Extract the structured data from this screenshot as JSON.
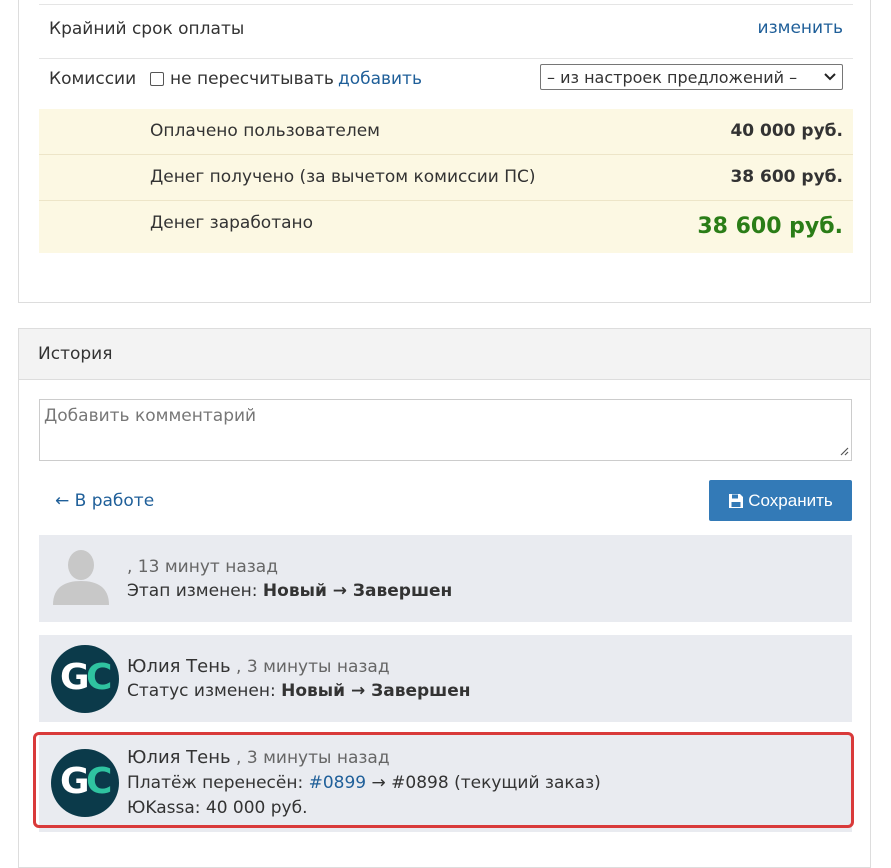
{
  "payment": {
    "deadline_label": "Крайний срок оплаты",
    "deadline_link": "изменить",
    "commission_label": "Комиссии",
    "no_recalc_label": "не пересчитывать",
    "add_link": "добавить",
    "commission_select": "– из настроек предложений –",
    "paid_label": "Оплачено пользователем",
    "paid_value": "40 000 руб.",
    "received_label": "Денег получено (за вычетом комиссии ПС)",
    "received_value": "38 600 руб.",
    "earned_label": "Денег заработано",
    "earned_value": "38 600 руб."
  },
  "history": {
    "title": "История",
    "comment_placeholder": "Добавить комментарий",
    "back_link": "← В работе",
    "save_label": "Сохранить",
    "entries": [
      {
        "author": "",
        "time": ", 13 минут назад",
        "line1_prefix": "Этап изменен: ",
        "line1_bold": "Новый → Завершен"
      },
      {
        "author": "Юлия Тень",
        "time": " , 3 минуты назад",
        "line1_prefix": "Статус изменен: ",
        "line1_bold": "Новый → Завершен"
      },
      {
        "author": "Юлия Тень",
        "time": " , 3 минуты назад",
        "line1_prefix": "Платёж перенесён: ",
        "line1_link": "#0899",
        "line1_suffix": " → #0898 (текущий заказ)",
        "line2": "ЮKassa: 40 000 руб."
      }
    ]
  },
  "colors": {
    "link": "#1f5f99",
    "button": "#337ab7",
    "summary_bg": "#fcf8e3",
    "earned": "#2a7d17",
    "entry_bg": "#e9ebf0",
    "highlight": "#d93a3a"
  },
  "icons": {
    "save": "floppy-disk-icon",
    "placeholder_avatar": "user-silhouette-icon",
    "avatar_logo": "gc-logo"
  }
}
